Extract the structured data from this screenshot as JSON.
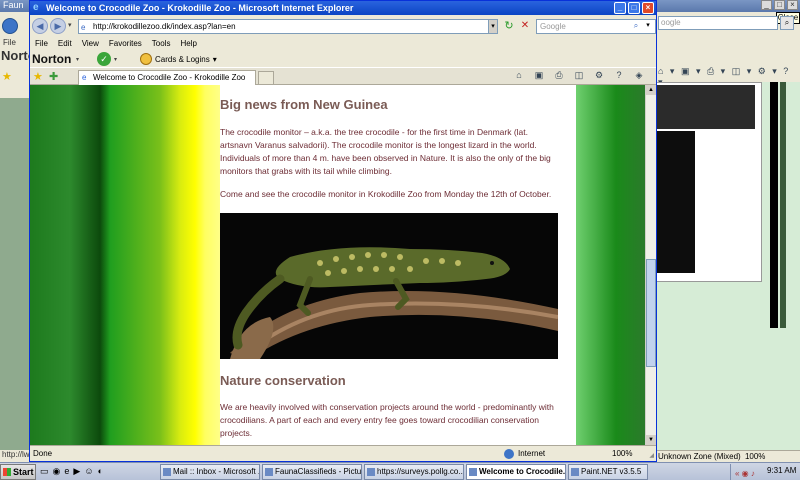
{
  "background_window": {
    "title": "Faun",
    "close_tooltip": "Close",
    "search_placeholder": "oogle",
    "menu_fragment": "File",
    "norton_fragment": "Norto",
    "status_fragment": "http://lw",
    "zone_text": "Unknown Zone (Mixed)",
    "zoom": "100%"
  },
  "window": {
    "title": "Welcome to Crocodile Zoo - Krokodille Zoo - Microsoft Internet Explorer",
    "address": "http://krokodillezoo.dk/index.asp?lan=en",
    "search_placeholder": "Google",
    "menu": [
      "File",
      "Edit",
      "View",
      "Favorites",
      "Tools",
      "Help"
    ],
    "norton": {
      "logo": "Norton",
      "cards": "Cards & Logins"
    },
    "tab_title": "Welcome to Crocodile Zoo - Krokodille Zoo",
    "status": {
      "text": "Done",
      "zone": "Internet",
      "zoom": "100%"
    }
  },
  "page": {
    "heading_news": "Big news from New Guinea",
    "para1": "The crocodile monitor – a.k.a. the tree crocodile - for the first time in Denmark (lat. artsnavn Varanus salvadorii). The crocodile monitor is the longest lizard in the world. Individuals of more than 4 m. have been observed in Nature. It is also the only of the big monitors that grabs with its tail while climbing.",
    "para2": "Come and see the crocodile monitor in Krokodille Zoo from Monday the 12th of October.",
    "heading_conservation": "Nature conservation",
    "para3": "We are heavily involved with conservation projects around the world - predominantly with crocodilians. A part of each and every entry fee goes toward crocodilian conservation projects."
  },
  "taskbar": {
    "start": "Start",
    "tasks": [
      "Mail :: Inbox - Microsoft ...",
      "FaunaClassifieds - Pictur...",
      "https://surveys.pollg.co...",
      "Welcome to Crocodile...",
      "Paint.NET v3.5.5"
    ],
    "clock": "9:31 AM"
  },
  "colors": {
    "heading": "#7a5b55",
    "body_text": "#6d2d35",
    "title_bar": "#0b45c4"
  }
}
